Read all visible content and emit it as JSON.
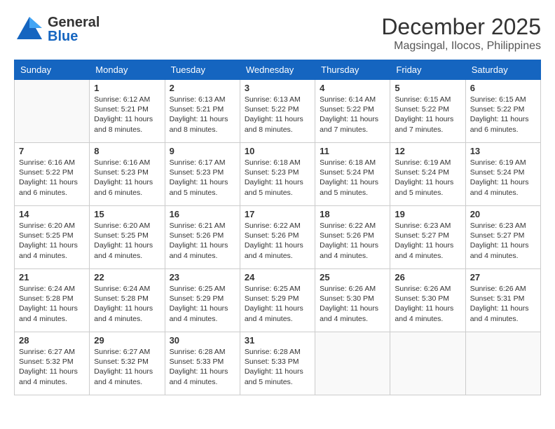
{
  "header": {
    "logo_general": "General",
    "logo_blue": "Blue",
    "month_title": "December 2025",
    "location": "Magsingal, Ilocos, Philippines"
  },
  "calendar": {
    "days_of_week": [
      "Sunday",
      "Monday",
      "Tuesday",
      "Wednesday",
      "Thursday",
      "Friday",
      "Saturday"
    ],
    "weeks": [
      [
        {
          "day": "",
          "info": ""
        },
        {
          "day": "1",
          "info": "Sunrise: 6:12 AM\nSunset: 5:21 PM\nDaylight: 11 hours\nand 8 minutes."
        },
        {
          "day": "2",
          "info": "Sunrise: 6:13 AM\nSunset: 5:21 PM\nDaylight: 11 hours\nand 8 minutes."
        },
        {
          "day": "3",
          "info": "Sunrise: 6:13 AM\nSunset: 5:22 PM\nDaylight: 11 hours\nand 8 minutes."
        },
        {
          "day": "4",
          "info": "Sunrise: 6:14 AM\nSunset: 5:22 PM\nDaylight: 11 hours\nand 7 minutes."
        },
        {
          "day": "5",
          "info": "Sunrise: 6:15 AM\nSunset: 5:22 PM\nDaylight: 11 hours\nand 7 minutes."
        },
        {
          "day": "6",
          "info": "Sunrise: 6:15 AM\nSunset: 5:22 PM\nDaylight: 11 hours\nand 6 minutes."
        }
      ],
      [
        {
          "day": "7",
          "info": "Sunrise: 6:16 AM\nSunset: 5:22 PM\nDaylight: 11 hours\nand 6 minutes."
        },
        {
          "day": "8",
          "info": "Sunrise: 6:16 AM\nSunset: 5:23 PM\nDaylight: 11 hours\nand 6 minutes."
        },
        {
          "day": "9",
          "info": "Sunrise: 6:17 AM\nSunset: 5:23 PM\nDaylight: 11 hours\nand 5 minutes."
        },
        {
          "day": "10",
          "info": "Sunrise: 6:18 AM\nSunset: 5:23 PM\nDaylight: 11 hours\nand 5 minutes."
        },
        {
          "day": "11",
          "info": "Sunrise: 6:18 AM\nSunset: 5:24 PM\nDaylight: 11 hours\nand 5 minutes."
        },
        {
          "day": "12",
          "info": "Sunrise: 6:19 AM\nSunset: 5:24 PM\nDaylight: 11 hours\nand 5 minutes."
        },
        {
          "day": "13",
          "info": "Sunrise: 6:19 AM\nSunset: 5:24 PM\nDaylight: 11 hours\nand 4 minutes."
        }
      ],
      [
        {
          "day": "14",
          "info": "Sunrise: 6:20 AM\nSunset: 5:25 PM\nDaylight: 11 hours\nand 4 minutes."
        },
        {
          "day": "15",
          "info": "Sunrise: 6:20 AM\nSunset: 5:25 PM\nDaylight: 11 hours\nand 4 minutes."
        },
        {
          "day": "16",
          "info": "Sunrise: 6:21 AM\nSunset: 5:26 PM\nDaylight: 11 hours\nand 4 minutes."
        },
        {
          "day": "17",
          "info": "Sunrise: 6:22 AM\nSunset: 5:26 PM\nDaylight: 11 hours\nand 4 minutes."
        },
        {
          "day": "18",
          "info": "Sunrise: 6:22 AM\nSunset: 5:26 PM\nDaylight: 11 hours\nand 4 minutes."
        },
        {
          "day": "19",
          "info": "Sunrise: 6:23 AM\nSunset: 5:27 PM\nDaylight: 11 hours\nand 4 minutes."
        },
        {
          "day": "20",
          "info": "Sunrise: 6:23 AM\nSunset: 5:27 PM\nDaylight: 11 hours\nand 4 minutes."
        }
      ],
      [
        {
          "day": "21",
          "info": "Sunrise: 6:24 AM\nSunset: 5:28 PM\nDaylight: 11 hours\nand 4 minutes."
        },
        {
          "day": "22",
          "info": "Sunrise: 6:24 AM\nSunset: 5:28 PM\nDaylight: 11 hours\nand 4 minutes."
        },
        {
          "day": "23",
          "info": "Sunrise: 6:25 AM\nSunset: 5:29 PM\nDaylight: 11 hours\nand 4 minutes."
        },
        {
          "day": "24",
          "info": "Sunrise: 6:25 AM\nSunset: 5:29 PM\nDaylight: 11 hours\nand 4 minutes."
        },
        {
          "day": "25",
          "info": "Sunrise: 6:26 AM\nSunset: 5:30 PM\nDaylight: 11 hours\nand 4 minutes."
        },
        {
          "day": "26",
          "info": "Sunrise: 6:26 AM\nSunset: 5:30 PM\nDaylight: 11 hours\nand 4 minutes."
        },
        {
          "day": "27",
          "info": "Sunrise: 6:26 AM\nSunset: 5:31 PM\nDaylight: 11 hours\nand 4 minutes."
        }
      ],
      [
        {
          "day": "28",
          "info": "Sunrise: 6:27 AM\nSunset: 5:32 PM\nDaylight: 11 hours\nand 4 minutes."
        },
        {
          "day": "29",
          "info": "Sunrise: 6:27 AM\nSunset: 5:32 PM\nDaylight: 11 hours\nand 4 minutes."
        },
        {
          "day": "30",
          "info": "Sunrise: 6:28 AM\nSunset: 5:33 PM\nDaylight: 11 hours\nand 4 minutes."
        },
        {
          "day": "31",
          "info": "Sunrise: 6:28 AM\nSunset: 5:33 PM\nDaylight: 11 hours\nand 5 minutes."
        },
        {
          "day": "",
          "info": ""
        },
        {
          "day": "",
          "info": ""
        },
        {
          "day": "",
          "info": ""
        }
      ]
    ]
  }
}
